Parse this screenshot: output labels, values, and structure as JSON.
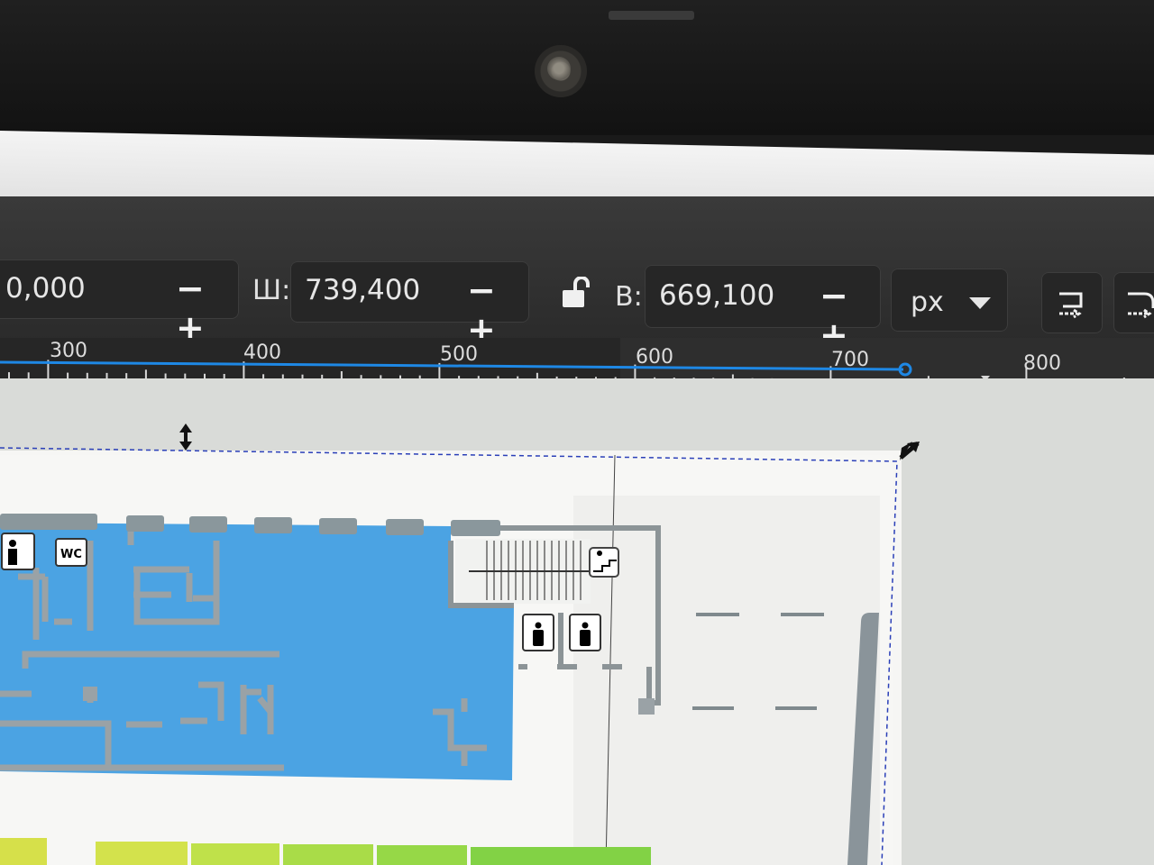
{
  "toolbar": {
    "x_value": "0,000",
    "width_label": "Ш:",
    "width_value": "739,400",
    "height_label": "В:",
    "height_value": "669,100",
    "unit": "px",
    "minus": "−",
    "plus": "+"
  },
  "ruler": {
    "ticks": [
      "300",
      "400",
      "500",
      "600",
      "700",
      "800"
    ]
  },
  "floorplan": {
    "wc_label": "WC"
  },
  "colors": {
    "toolbar_bg": "#333333",
    "field_bg": "#262626",
    "ruler_selection": "#1e88e5",
    "room_blue": "#4ba3e3",
    "wall_gray": "#8a9499",
    "zone_yellow": "#d6e04a",
    "zone_green": "#8fd448"
  }
}
